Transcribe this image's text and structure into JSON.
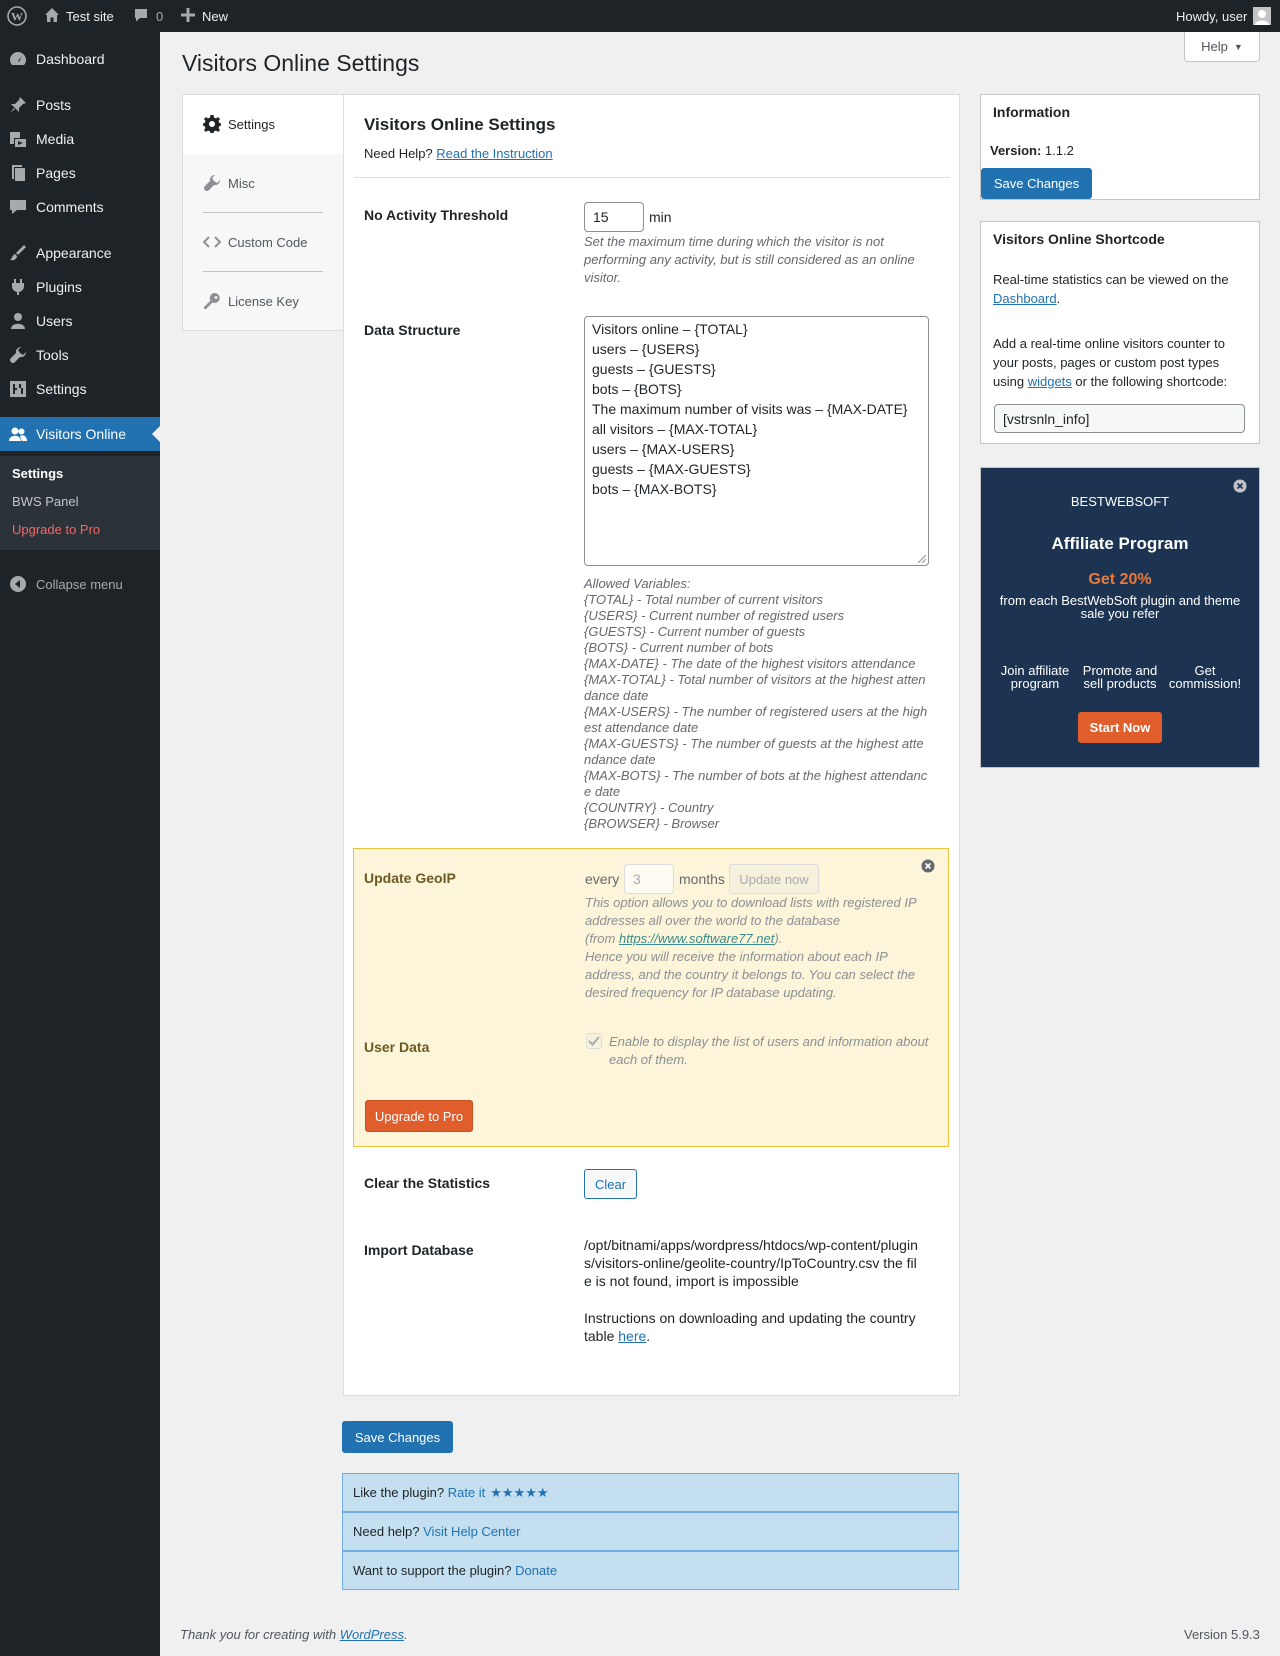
{
  "adminbar": {
    "site_name": "Test site",
    "comments_count": "0",
    "new_label": "New",
    "greeting": "Howdy, user"
  },
  "sidebar": {
    "items": [
      {
        "label": "Dashboard",
        "icon": "dashboard-icon"
      },
      {
        "label": "Posts",
        "icon": "pin-icon"
      },
      {
        "label": "Media",
        "icon": "media-icon"
      },
      {
        "label": "Pages",
        "icon": "pages-icon"
      },
      {
        "label": "Comments",
        "icon": "comment-icon"
      },
      {
        "label": "Appearance",
        "icon": "brush-icon"
      },
      {
        "label": "Plugins",
        "icon": "plugin-icon"
      },
      {
        "label": "Users",
        "icon": "user-icon"
      },
      {
        "label": "Tools",
        "icon": "wrench-icon"
      },
      {
        "label": "Settings",
        "icon": "settings-icon"
      },
      {
        "label": "Visitors Online",
        "icon": "visitors-icon"
      }
    ],
    "submenu": [
      "Settings",
      "BWS Panel",
      "Upgrade to Pro"
    ],
    "collapse": "Collapse menu"
  },
  "page": {
    "title": "Visitors Online Settings",
    "help": "Help"
  },
  "tabs": [
    "Settings",
    "Misc",
    "Custom Code",
    "License Key"
  ],
  "settings": {
    "heading": "Visitors Online Settings",
    "need_help": "Need Help?",
    "read_instruction": "Read the Instruction",
    "threshold_label": "No Activity Threshold",
    "threshold_value": "15",
    "threshold_unit": "min",
    "threshold_desc": "Set the maximum time during which the visitor is not performing any activity, but is still considered as an online visitor.",
    "data_structure_label": "Data Structure",
    "data_structure_lines": [
      "Visitors online – {TOTAL}",
      "users – {USERS}",
      "guests – {GUESTS}",
      "bots – {BOTS}",
      "The maximum number of visits was – {MAX-DATE}",
      "all visitors – {MAX-TOTAL}",
      "users – {MAX-USERS}",
      "guests – {MAX-GUESTS}",
      "bots – {MAX-BOTS}"
    ],
    "allowed_vars_lines": [
      "Allowed Variables:",
      "{TOTAL} - Total number of current visitors",
      "{USERS} - Current number of registred users",
      "{GUESTS} - Current number of guests",
      "{BOTS} - Current number of bots",
      "{MAX-DATE} - The date of the highest visitors attendance",
      "{MAX-TOTAL} - Total number of visitors at the highest atten",
      "dance date",
      "{MAX-USERS} - The number of registered users at the high",
      "est attendance date",
      "{MAX-GUESTS} - The number of guests at the highest atte",
      "ndance date",
      "{MAX-BOTS} - The number of bots at the highest attendanc",
      "e date",
      "{COUNTRY} - Country",
      "{BROWSER} - Browser"
    ],
    "geoip_label": "Update GeoIP",
    "geoip_every": "every",
    "geoip_value": "3",
    "geoip_months": "months",
    "geoip_update_now": "Update now",
    "geoip_desc_1": "This option allows you to download lists with registered IP addresses all over the world to the database",
    "geoip_desc_from": "(from",
    "geoip_link": "https://www.software77.net",
    "geoip_desc_close": ").",
    "geoip_desc_2": "Hence you will receive the information about each IP address, and the country it belongs to. You can select the desired frequency for IP database updating.",
    "userdata_label": "User Data",
    "userdata_desc": "Enable to display the list of users and information about each of them.",
    "upgrade_btn": "Upgrade to Pro",
    "clear_label": "Clear the Statistics",
    "clear_btn": "Clear",
    "import_label": "Import Database",
    "import_text": "/opt/bitnami/apps/wordpress/htdocs/wp-content/plugins/visitors-online/geolite-country/IpToCountry.csv the file is not found, import is impossible",
    "import_instructions": "Instructions on downloading and updating the country table",
    "import_here": "here",
    "import_period": "."
  },
  "save_changes": "Save Changes",
  "info_box": {
    "title": "Information",
    "version_label": "Version:",
    "version_value": "1.1.2",
    "save": "Save Changes"
  },
  "shortcode_box": {
    "title": "Visitors Online Shortcode",
    "text1": "Real-time statistics can be viewed on the",
    "dashboard_link": "Dashboard",
    "period": ".",
    "text2": "Add a real-time online visitors counter to your posts, pages or custom post types using",
    "widgets_link": "widgets",
    "text3": "or the following shortcode:",
    "shortcode": "[vstrsnln_info]"
  },
  "affiliate": {
    "brand": "BESTWEBSOFT",
    "title": "Affiliate Program",
    "get": "Get 20%",
    "sub": "from each BestWebSoft plugin and theme sale you refer",
    "steps": [
      "Join affiliate program",
      "Promote and sell products",
      "Get commission!"
    ],
    "cta": "Start Now",
    "colors": {
      "bg": "#1c3451",
      "accent": "#ea7a3a",
      "button": "#e05e2b"
    }
  },
  "footer_boxes": {
    "rate_q": "Like the plugin?",
    "rate_link": "Rate it",
    "help_q": "Need help?",
    "help_link": "Visit Help Center",
    "support_q": "Want to support the plugin?",
    "support_link": "Donate",
    "stars": 5
  },
  "wp_footer": {
    "thanks": "Thank you for creating with",
    "wp_link": "WordPress",
    "period": ".",
    "version": "Version 5.9.3"
  },
  "colors": {
    "primary": "#2271b1",
    "adminbar": "#1d2327",
    "pro_bg": "#fcf5d9",
    "upgrade_red": "#d63638"
  }
}
